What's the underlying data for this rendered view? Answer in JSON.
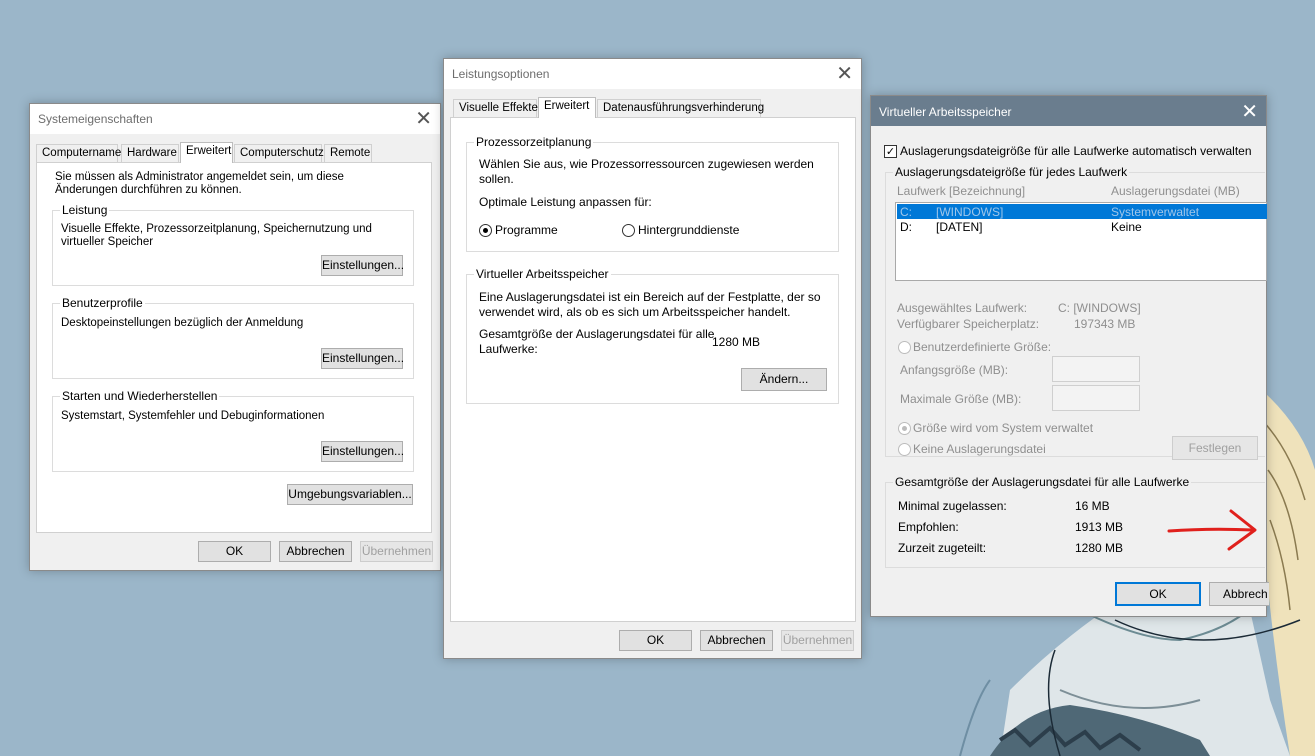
{
  "win1": {
    "title": "Systemeigenschaften",
    "tabs": [
      "Computername",
      "Hardware",
      "Erweitert",
      "Computerschutz",
      "Remote"
    ],
    "admin_note": "Sie müssen als Administrator angemeldet sein, um diese Änderungen durchführen zu können.",
    "groups": [
      {
        "label": "Leistung",
        "text": "Visuelle Effekte, Prozessorzeitplanung, Speichernutzung und virtueller Speicher",
        "button": "Einstellungen..."
      },
      {
        "label": "Benutzerprofile",
        "text": "Desktopeinstellungen bezüglich der Anmeldung",
        "button": "Einstellungen..."
      },
      {
        "label": "Starten und Wiederherstellen",
        "text": "Systemstart, Systemfehler und Debuginformationen",
        "button": "Einstellungen..."
      }
    ],
    "env_button": "Umgebungsvariablen...",
    "ok": "OK",
    "cancel": "Abbrechen",
    "apply": "Übernehmen"
  },
  "win2": {
    "title": "Leistungsoptionen",
    "tabs": [
      "Visuelle Effekte",
      "Erweitert",
      "Datenausführungsverhinderung"
    ],
    "cpu_group": "Prozessorzeitplanung",
    "cpu_desc": "Wählen Sie aus, wie Prozessorressourcen zugewiesen werden sollen.",
    "optimize_label": "Optimale Leistung anpassen für:",
    "radio_programs": "Programme",
    "radio_services": "Hintergrunddienste",
    "vm_group": "Virtueller Arbeitsspeicher",
    "vm_desc": "Eine Auslagerungsdatei ist ein Bereich auf der Festplatte, der so verwendet wird, als ob es sich um Arbeitsspeicher handelt.",
    "total_label": "Gesamtgröße der Auslagerungsdatei für alle Laufwerke:",
    "total_value": "1280 MB",
    "change_button": "Ändern...",
    "ok": "OK",
    "cancel": "Abbrechen",
    "apply": "Übernehmen"
  },
  "win3": {
    "title": "Virtueller Arbeitsspeicher",
    "auto_manage": "Auslagerungsdateigröße für alle Laufwerke automatisch verwalten",
    "auto_checked": true,
    "per_drive_group": "Auslagerungsdateigröße für jedes Laufwerk",
    "col_drive": "Laufwerk [Bezeichnung]",
    "col_pagefile": "Auslagerungsdatei (MB)",
    "drives": [
      {
        "letter": "C:",
        "label": "[WINDOWS]",
        "pagefile": "Systemverwaltet",
        "selected": true
      },
      {
        "letter": "D:",
        "label": "[DATEN]",
        "pagefile": "Keine",
        "selected": false
      }
    ],
    "sel_drive_label": "Ausgewähltes Laufwerk:",
    "sel_drive_value": "C:  [WINDOWS]",
    "free_label": "Verfügbarer Speicherplatz:",
    "free_value": "197343 MB",
    "custom_size": "Benutzerdefinierte Größe:",
    "initial_size": "Anfangsgröße (MB):",
    "max_size": "Maximale Größe (MB):",
    "system_managed": "Größe wird vom System verwaltet",
    "no_pagefile": "Keine Auslagerungsdatei",
    "set_button": "Festlegen",
    "totals_group": "Gesamtgröße der Auslagerungsdatei für alle Laufwerke",
    "min_label": "Minimal zugelassen:",
    "min_value": "16 MB",
    "rec_label": "Empfohlen:",
    "rec_value": "1913 MB",
    "cur_label": "Zurzeit zugeteilt:",
    "cur_value": "1280 MB",
    "ok": "OK",
    "cancel": "Abbrech",
    "arrow_color": "#e0201c"
  }
}
